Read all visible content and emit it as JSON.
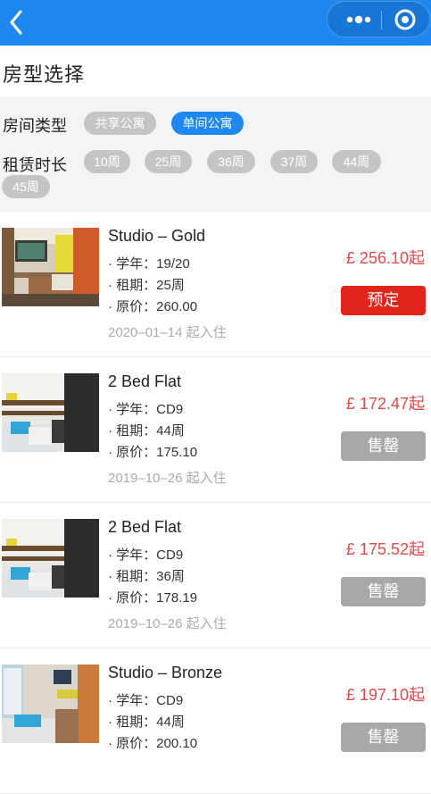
{
  "page": {
    "title": "房型选择"
  },
  "filters": {
    "room_type_label": "房间类型",
    "room_types": [
      "共享公寓",
      "单间公寓"
    ],
    "duration_label": "租赁时长",
    "durations": [
      "10周",
      "25周",
      "36周",
      "37周",
      "44周",
      "45周"
    ]
  },
  "colors": {
    "accent": "#1e88f0",
    "price": "#e24a4a",
    "book": "#e0251a",
    "sold": "#a8a8a8"
  },
  "rooms": [
    {
      "name": "Studio – Gold",
      "year": "· 学年：19/20",
      "term": "· 租期：25周",
      "original": "· 原价：260.00",
      "date": "2020–01–14 起入住",
      "price": "£ 256.10起",
      "button": "预定"
    },
    {
      "name": "2 Bed Flat",
      "year": "· 学年：CD9",
      "term": "· 租期：44周",
      "original": "· 原价：175.10",
      "date": "2019–10–26 起入住",
      "price": "£ 172.47起",
      "button": "售罄"
    },
    {
      "name": "2 Bed Flat",
      "year": "· 学年：CD9",
      "term": "· 租期：36周",
      "original": "· 原价：178.19",
      "date": "2019–10–26 起入住",
      "price": "£ 175.52起",
      "button": "售罄"
    },
    {
      "name": "Studio – Bronze",
      "year": "· 学年：CD9",
      "term": "· 租期：44周",
      "original": "· 原价：200.10",
      "price": "£ 197.10起",
      "button": "售罄"
    }
  ]
}
